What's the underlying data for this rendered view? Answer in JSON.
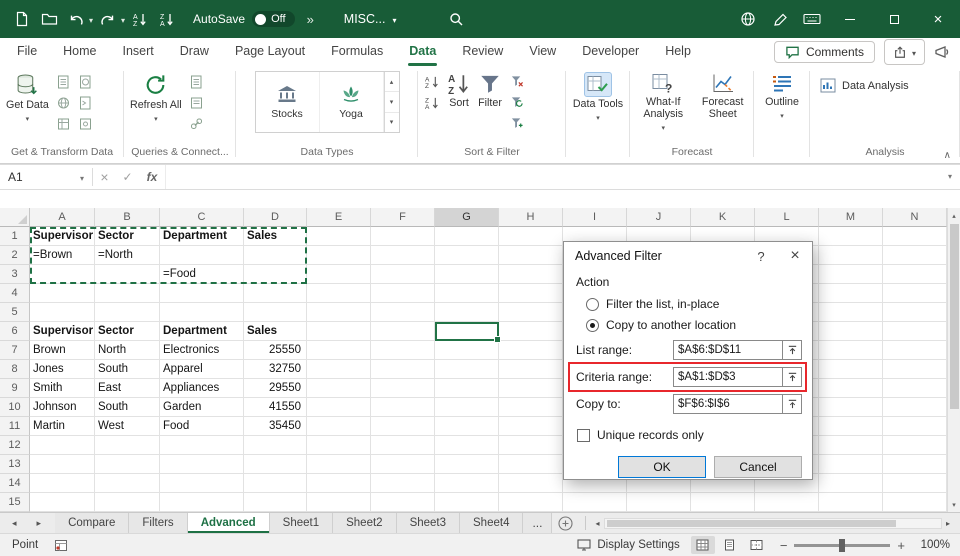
{
  "colors": {
    "titlebar_green": "#185c37",
    "excel_green": "#217346",
    "annotation_red": "#e8272c",
    "default_button_blue": "#0078d7"
  },
  "titlebar": {
    "autosave_label": "AutoSave",
    "autosave_state": "Off",
    "doc_title": "MISC..."
  },
  "menubar": {
    "tabs": [
      "File",
      "Home",
      "Insert",
      "Draw",
      "Page Layout",
      "Formulas",
      "Data",
      "Review",
      "View",
      "Developer",
      "Help"
    ],
    "active": "Data",
    "comments_label": "Comments"
  },
  "ribbon": {
    "get_data": "Get Data",
    "get_transform_label": "Get & Transform Data",
    "refresh_all": "Refresh All",
    "queries_label": "Queries & Connect...",
    "stocks": "Stocks",
    "yoga": "Yoga",
    "data_types_label": "Data Types",
    "sort": "Sort",
    "filter": "Filter",
    "sort_filter_label": "Sort & Filter",
    "data_tools": "Data Tools",
    "what_if_analysis": "What-If Analysis",
    "forecast_sheet": "Forecast Sheet",
    "forecast_label": "Forecast",
    "outline": "Outline",
    "data_analysis": "Data Analysis",
    "analysis_label": "Analysis"
  },
  "formula_bar": {
    "name_box": "A1",
    "fx": "fx",
    "formula": ""
  },
  "grid": {
    "columns": [
      "A",
      "B",
      "C",
      "D",
      "E",
      "F",
      "G",
      "H",
      "I",
      "J",
      "K",
      "L",
      "M",
      "N"
    ],
    "selected_column": "G",
    "selected_cell": "G6",
    "rows": [
      "1",
      "2",
      "3",
      "4",
      "5",
      "6",
      "7",
      "8",
      "9",
      "10",
      "11",
      "12",
      "13",
      "14",
      "15"
    ],
    "cells": [
      {
        "ref": "A1",
        "v": "Supervisor",
        "bold": true
      },
      {
        "ref": "B1",
        "v": "Sector",
        "bold": true
      },
      {
        "ref": "C1",
        "v": "Department",
        "bold": true
      },
      {
        "ref": "D1",
        "v": "Sales",
        "bold": true
      },
      {
        "ref": "A2",
        "v": "=Brown"
      },
      {
        "ref": "B2",
        "v": "=North"
      },
      {
        "ref": "C3",
        "v": "=Food"
      },
      {
        "ref": "A6",
        "v": "Supervisor",
        "bold": true
      },
      {
        "ref": "B6",
        "v": "Sector",
        "bold": true
      },
      {
        "ref": "C6",
        "v": "Department",
        "bold": true
      },
      {
        "ref": "D6",
        "v": "Sales",
        "bold": true
      },
      {
        "ref": "A7",
        "v": "Brown"
      },
      {
        "ref": "B7",
        "v": "North"
      },
      {
        "ref": "C7",
        "v": "Electronics"
      },
      {
        "ref": "D7",
        "v": "25550",
        "num": true
      },
      {
        "ref": "A8",
        "v": "Jones"
      },
      {
        "ref": "B8",
        "v": "South"
      },
      {
        "ref": "C8",
        "v": "Apparel"
      },
      {
        "ref": "D8",
        "v": "32750",
        "num": true
      },
      {
        "ref": "A9",
        "v": "Smith"
      },
      {
        "ref": "B9",
        "v": "East"
      },
      {
        "ref": "C9",
        "v": "Appliances"
      },
      {
        "ref": "D9",
        "v": "29550",
        "num": true
      },
      {
        "ref": "A10",
        "v": "Johnson"
      },
      {
        "ref": "B10",
        "v": "South"
      },
      {
        "ref": "C10",
        "v": "Garden"
      },
      {
        "ref": "D10",
        "v": "41550",
        "num": true
      },
      {
        "ref": "A11",
        "v": "Martin"
      },
      {
        "ref": "B11",
        "v": "West"
      },
      {
        "ref": "C11",
        "v": "Food"
      },
      {
        "ref": "D11",
        "v": "35450",
        "num": true
      }
    ]
  },
  "dialog": {
    "title": "Advanced Filter",
    "action_label": "Action",
    "radio_filter_in_place": "Filter the list, in-place",
    "radio_copy_to_location": "Copy to another location",
    "selected_action": "Copy to another location",
    "list_range_label": "List range:",
    "list_range_value": "$A$6:$D$11",
    "criteria_range_label": "Criteria range:",
    "criteria_range_value": "$A$1:$D$3",
    "copy_to_label": "Copy to:",
    "copy_to_value": "$F$6:$I$6",
    "unique_records_label": "Unique records only",
    "unique_records_checked": false,
    "ok_label": "OK",
    "cancel_label": "Cancel"
  },
  "sheet_tabs": {
    "tabs": [
      "Compare",
      "Filters",
      "Advanced",
      "Sheet1",
      "Sheet2",
      "Sheet3",
      "Sheet4"
    ],
    "active": "Advanced",
    "more_label": "..."
  },
  "status_bar": {
    "mode": "Point",
    "display_settings": "Display Settings",
    "zoom": "100%"
  }
}
